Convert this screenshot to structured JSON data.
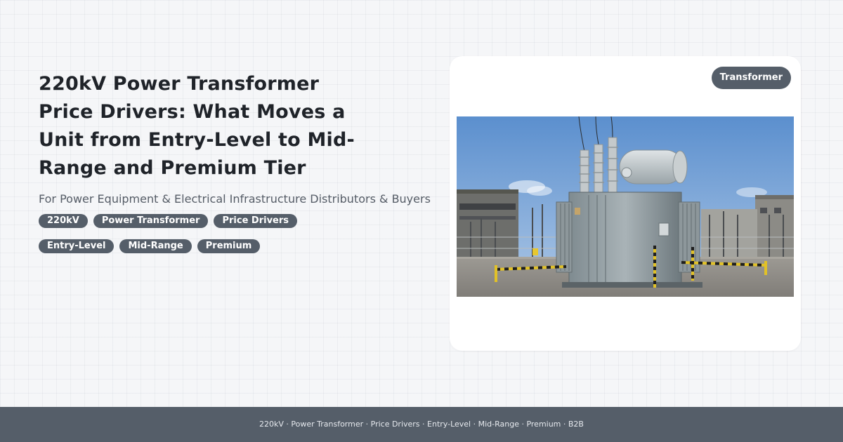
{
  "header": {
    "title": "220kV Power Transformer Price Drivers: What Moves a Unit from Entry-Level to Mid-Range and Premium Tier",
    "subtitle": "For Power Equipment & Electrical Infrastructure Distributors & Buyers"
  },
  "tags": [
    "220kV",
    "Power Transformer",
    "Price Drivers",
    "Entry-Level",
    "Mid-Range",
    "Premium"
  ],
  "card": {
    "badge": "Transformer"
  },
  "footer": {
    "text": "220kV · Power Transformer · Price Drivers · Entry-Level · Mid-Range · Premium · B2B"
  },
  "colors": {
    "background": "#f5f6f8",
    "accent": "#555e69",
    "title": "#1f2329"
  }
}
